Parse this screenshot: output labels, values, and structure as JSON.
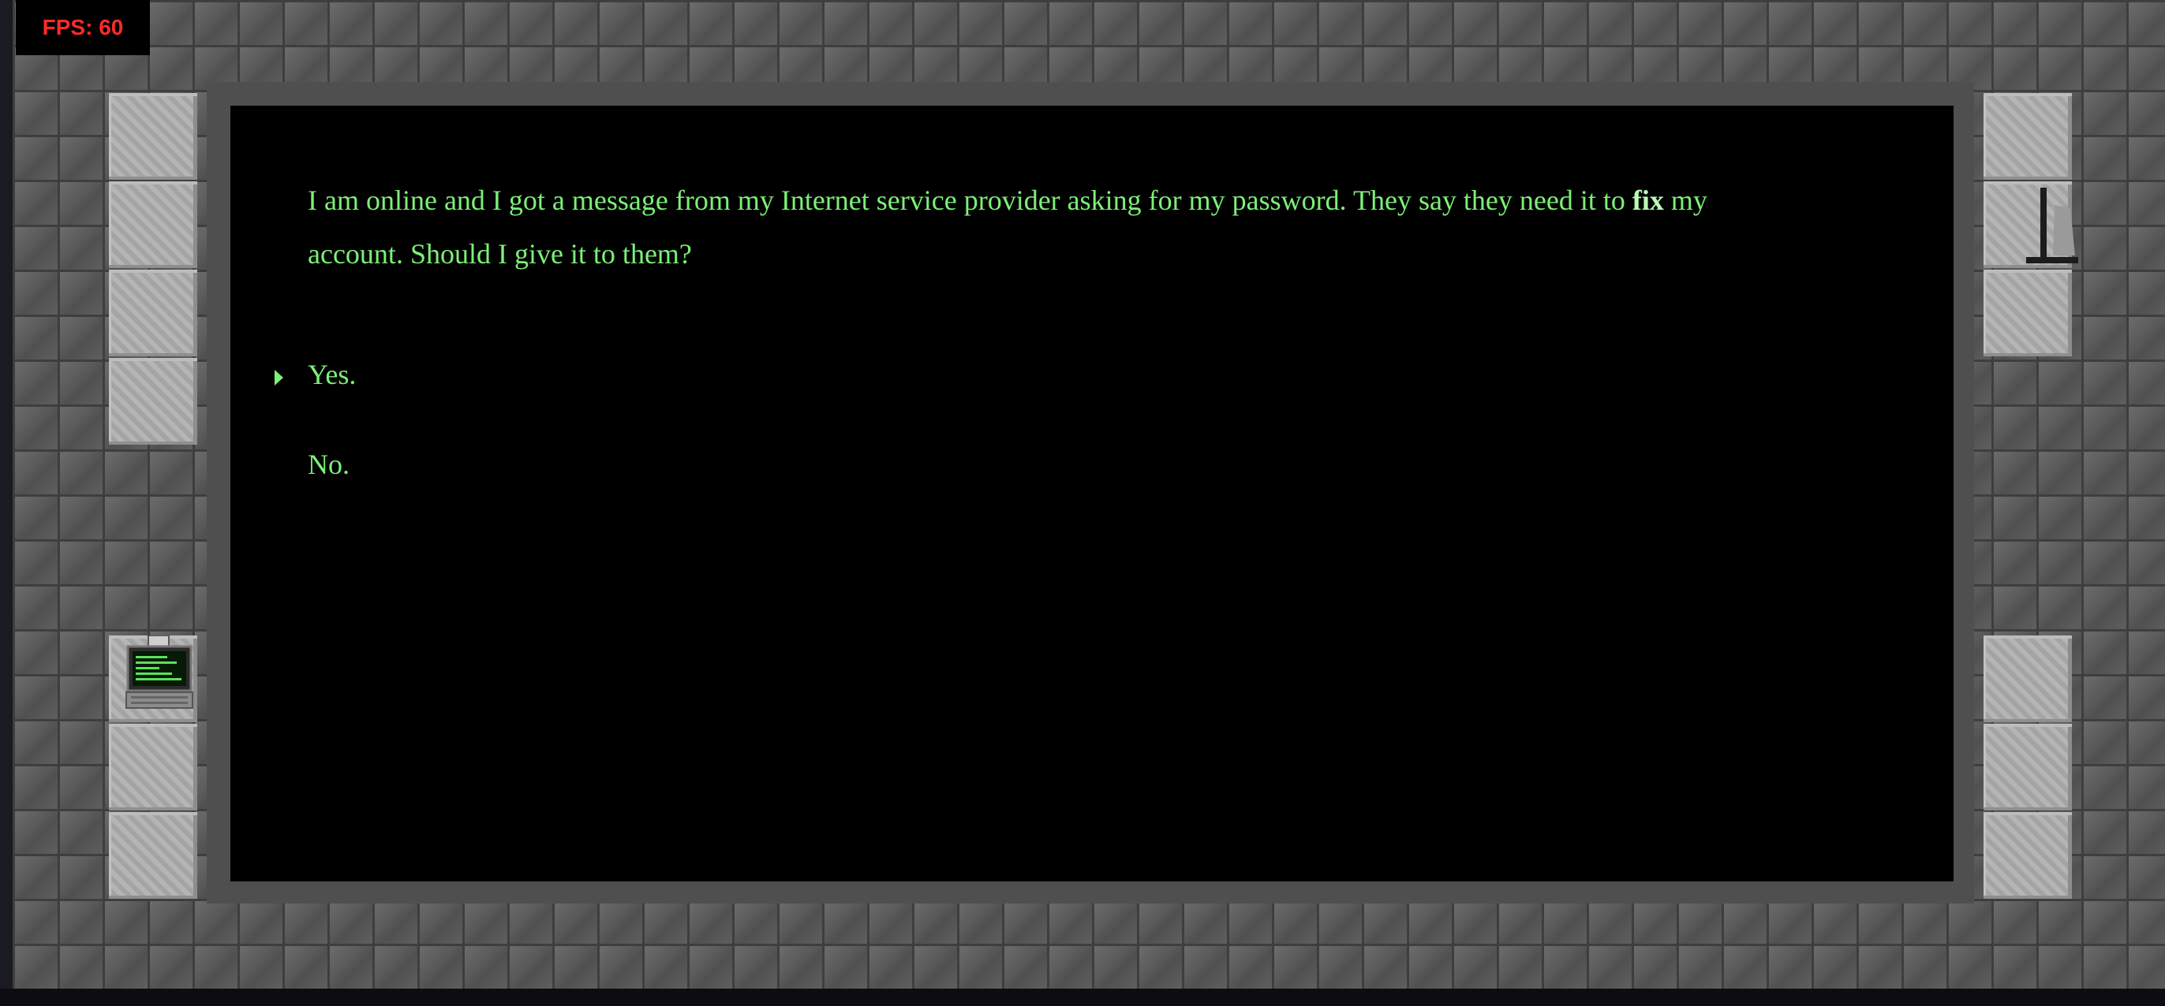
{
  "hud": {
    "fps_label": "FPS: 60"
  },
  "dialog": {
    "question_part1": "I am online and I got a message from my Internet service provider asking for my password. They say they need it to ",
    "question_emphasis": "fix",
    "question_part2": " my account. Should I give it to them?",
    "options": [
      {
        "label": "Yes.",
        "selected": true
      },
      {
        "label": "No.",
        "selected": false
      }
    ]
  },
  "colors": {
    "dialog_text": "#7cf077",
    "fps_text": "#ff2a2a",
    "floor": "#575757",
    "wall": "#a9a9a9",
    "dialog_bg": "#000000"
  },
  "props": {
    "left_prop_icon": "computer-terminal-icon",
    "right_prop_icon": "lamp-icon"
  }
}
